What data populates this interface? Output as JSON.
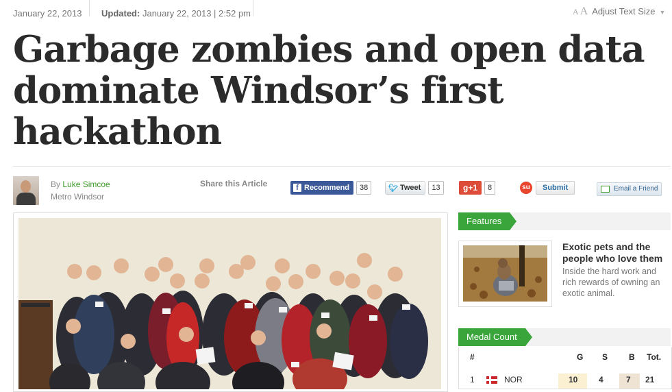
{
  "meta": {
    "date": "January 22, 2013",
    "updated_label": "Updated:",
    "updated_value": "January 22, 2013 | 2:52 pm",
    "text_size_small": "A",
    "text_size_big": "A",
    "text_size_label": "Adjust Text Size"
  },
  "article": {
    "headline": "Garbage zombies and open data dominate Windsor’s first hackathon",
    "byline_prefix": "By",
    "author": "Luke Simcoe",
    "publication": "Metro Windsor"
  },
  "share": {
    "title": "Share this Article",
    "facebook_label": "Recommend",
    "facebook_count": "38",
    "twitter_label": "Tweet",
    "twitter_count": "13",
    "gplus_label": "+1",
    "gplus_count": "8",
    "stumble_label": "Submit",
    "email_label": "Email a Friend"
  },
  "sidebar": {
    "features_tab": "Features",
    "feature_title": "Exotic pets and the people who love them",
    "feature_desc": "Inside the hard work and rich rewards of owning an exotic animal.",
    "medal_tab": "Medal Count",
    "medal_headers": {
      "rank": "#",
      "gold": "G",
      "silver": "S",
      "bronze": "B",
      "total": "Tot."
    },
    "medal_rows": [
      {
        "rank": "1",
        "country": "NOR",
        "gold": "10",
        "silver": "4",
        "bronze": "7",
        "total": "21"
      }
    ]
  },
  "colors": {
    "accent_green": "#3aa53b",
    "link_green": "#3f9b2a",
    "facebook": "#3b5998",
    "gplus": "#dd4b39"
  }
}
